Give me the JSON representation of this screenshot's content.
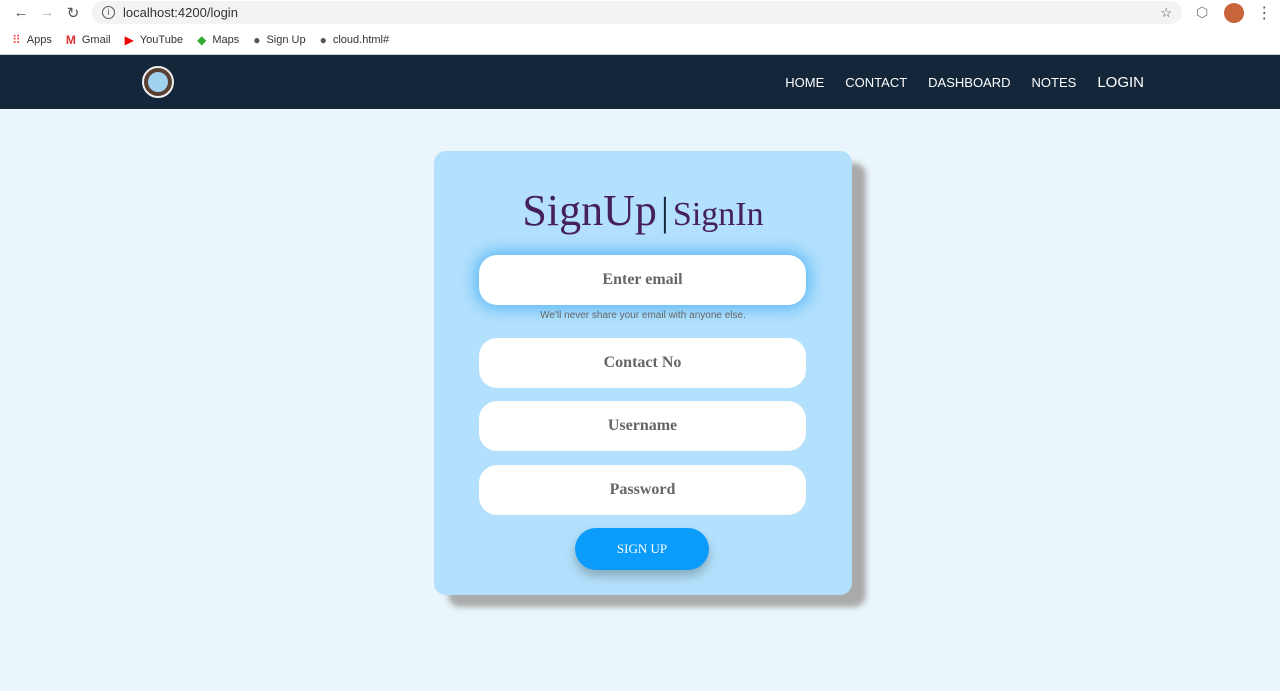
{
  "browser": {
    "url": "localhost:4200/login",
    "bookmarks": [
      {
        "label": "Apps",
        "icon": "apps-grid-icon"
      },
      {
        "label": "Gmail",
        "icon": "gmail-icon"
      },
      {
        "label": "YouTube",
        "icon": "youtube-icon"
      },
      {
        "label": "Maps",
        "icon": "maps-icon"
      },
      {
        "label": "Sign Up",
        "icon": "globe-icon"
      },
      {
        "label": "cloud.html#",
        "icon": "globe-icon"
      }
    ]
  },
  "navbar": {
    "links": [
      "HOME",
      "CONTACT",
      "DASHBOARD",
      "NOTES",
      "LOGIN"
    ]
  },
  "form": {
    "title_signup": "SignUp",
    "separator": "|",
    "title_signin": "SignIn",
    "email_placeholder": "Enter email",
    "email_help": "We'll never share your email with anyone else.",
    "contact_placeholder": "Contact No",
    "username_placeholder": "Username",
    "password_placeholder": "Password",
    "submit": "SIGN UP"
  }
}
